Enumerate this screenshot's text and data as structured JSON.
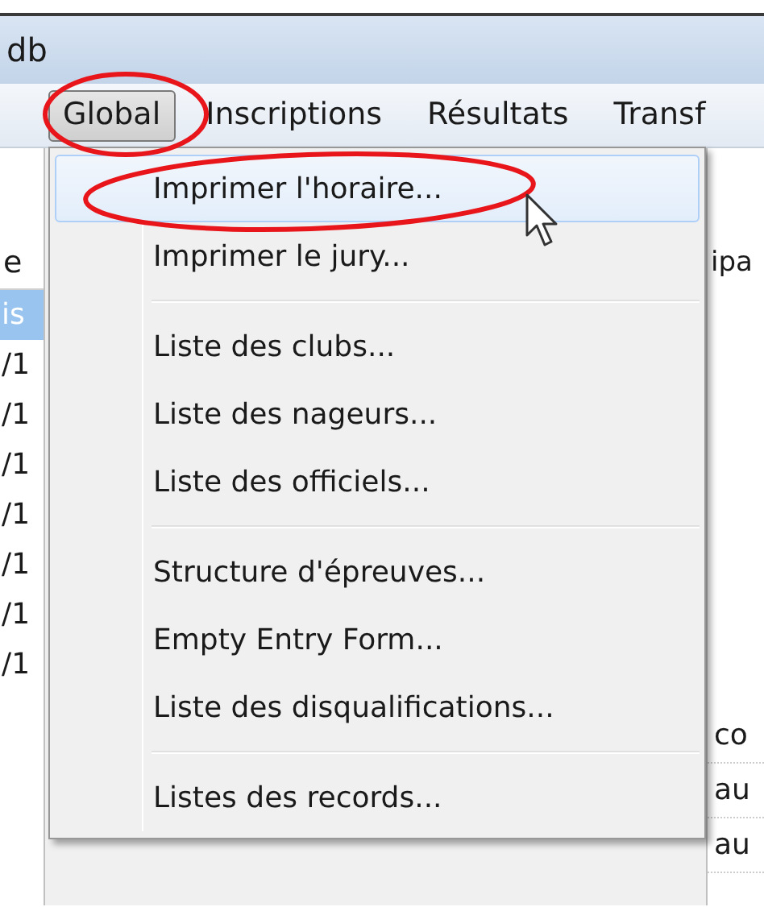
{
  "window": {
    "title": "db"
  },
  "menubar": [
    {
      "label": "Global",
      "selected": true
    },
    {
      "label": "Inscriptions",
      "selected": false
    },
    {
      "label": "Résultats",
      "selected": false
    },
    {
      "label": "Transf",
      "selected": false
    }
  ],
  "left_list": {
    "header": "e",
    "rows": [
      {
        "text": "is",
        "selected": true
      },
      {
        "text": "/1",
        "selected": false
      },
      {
        "text": "/1",
        "selected": false
      },
      {
        "text": "/1",
        "selected": false
      },
      {
        "text": "/1",
        "selected": false
      },
      {
        "text": "/1",
        "selected": false
      },
      {
        "text": "/1",
        "selected": false
      },
      {
        "text": "/1",
        "selected": false
      }
    ]
  },
  "right_panel": {
    "header": "ipa",
    "rows": [
      "co",
      "au",
      "au"
    ]
  },
  "menu": {
    "items": [
      {
        "kind": "item",
        "label": "Imprimer l'horaire...",
        "selected": true
      },
      {
        "kind": "item",
        "label": "Imprimer le jury...",
        "selected": false
      },
      {
        "kind": "separator"
      },
      {
        "kind": "item",
        "label": "Liste des clubs...",
        "selected": false
      },
      {
        "kind": "item",
        "label": "Liste des nageurs...",
        "selected": false
      },
      {
        "kind": "item",
        "label": "Liste des officiels...",
        "selected": false
      },
      {
        "kind": "separator"
      },
      {
        "kind": "item",
        "label": "Structure d'épreuves...",
        "selected": false
      },
      {
        "kind": "item",
        "label": "Empty Entry Form...",
        "selected": false
      },
      {
        "kind": "item",
        "label": "Liste des disqualifications...",
        "selected": false
      },
      {
        "kind": "separator"
      },
      {
        "kind": "item",
        "label": "Listes des records...",
        "selected": false
      }
    ]
  }
}
